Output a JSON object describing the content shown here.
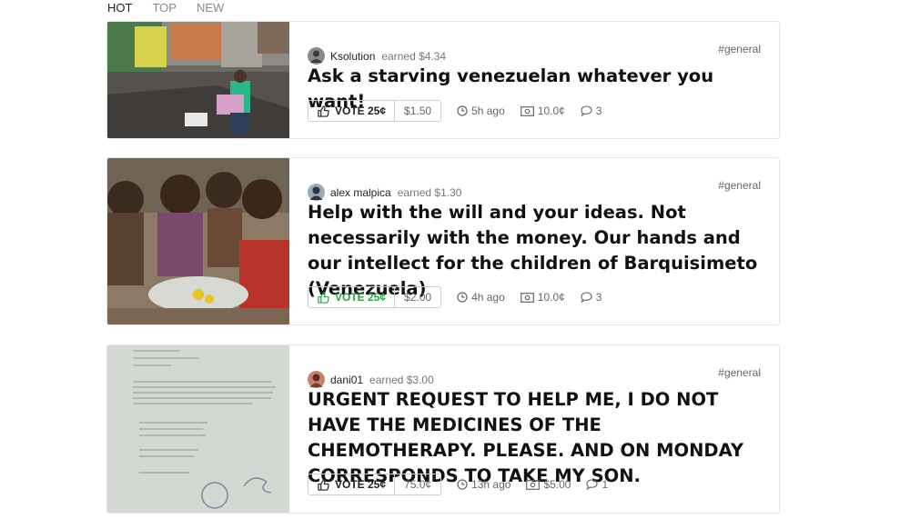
{
  "tabs": [
    {
      "label": "HOT",
      "active": true
    },
    {
      "label": "TOP",
      "active": false
    },
    {
      "label": "NEW",
      "active": false
    }
  ],
  "posts": [
    {
      "author": "Ksolution",
      "earned": "earned $4.34",
      "tag": "#general",
      "title": "Ask a starving venezuelan whatever you want!",
      "vote_label": "VOTE 25¢",
      "vote_amount": "$1.50",
      "time": "5h ago",
      "reward": "10.0¢",
      "comments": "3",
      "voted": false
    },
    {
      "author": "alex malpica",
      "earned": "earned $1.30",
      "tag": "#general",
      "title": "Help with the will and your ideas. Not necessarily with the money. Our hands and our intellect for the children of Barquisimeto (Venezuela)",
      "vote_label": "VOTE 25¢",
      "vote_amount": "$2.00",
      "time": "4h ago",
      "reward": "10.0¢",
      "comments": "3",
      "voted": true
    },
    {
      "author": "dani01",
      "earned": "earned $3.00",
      "tag": "#general",
      "title": "URGENT REQUEST TO HELP ME, I DO NOT HAVE THE MEDICINES OF THE CHEMOTHERAPY. PLEASE. AND ON MONDAY CORRESPONDS TO TAKE MY SON.",
      "vote_label": "VOTE 25¢",
      "vote_amount": "75.0¢",
      "time": "13h ago",
      "reward": "$5.00",
      "comments": "1",
      "voted": false
    }
  ],
  "colors": {
    "voted_green": "#2ea043"
  }
}
